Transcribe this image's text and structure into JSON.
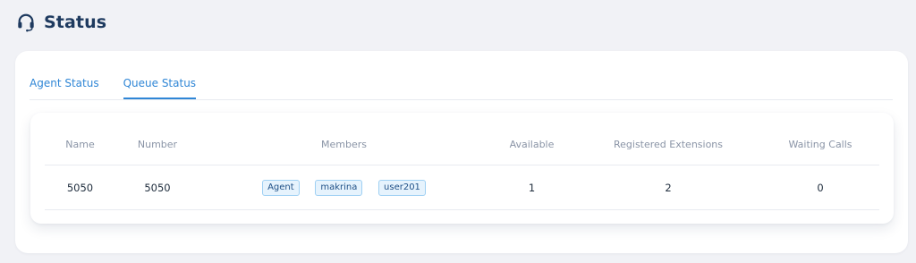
{
  "header": {
    "title": "Status",
    "icon": "headset-icon"
  },
  "tabs": [
    {
      "label": "Agent Status",
      "active": false
    },
    {
      "label": "Queue Status",
      "active": true
    }
  ],
  "table": {
    "columns": [
      "Name",
      "Number",
      "Members",
      "Available",
      "Registered Extensions",
      "Waiting Calls"
    ],
    "rows": [
      {
        "name": "5050",
        "number": "5050",
        "members": [
          "Agent",
          "makrina",
          "user201"
        ],
        "available": "1",
        "registered_extensions": "2",
        "waiting_calls": "0"
      }
    ]
  },
  "colors": {
    "accent": "#2f86d6",
    "title": "#1e3a5f",
    "tag_bg": "#e6f3fd",
    "tag_border": "#9fd0f3"
  }
}
